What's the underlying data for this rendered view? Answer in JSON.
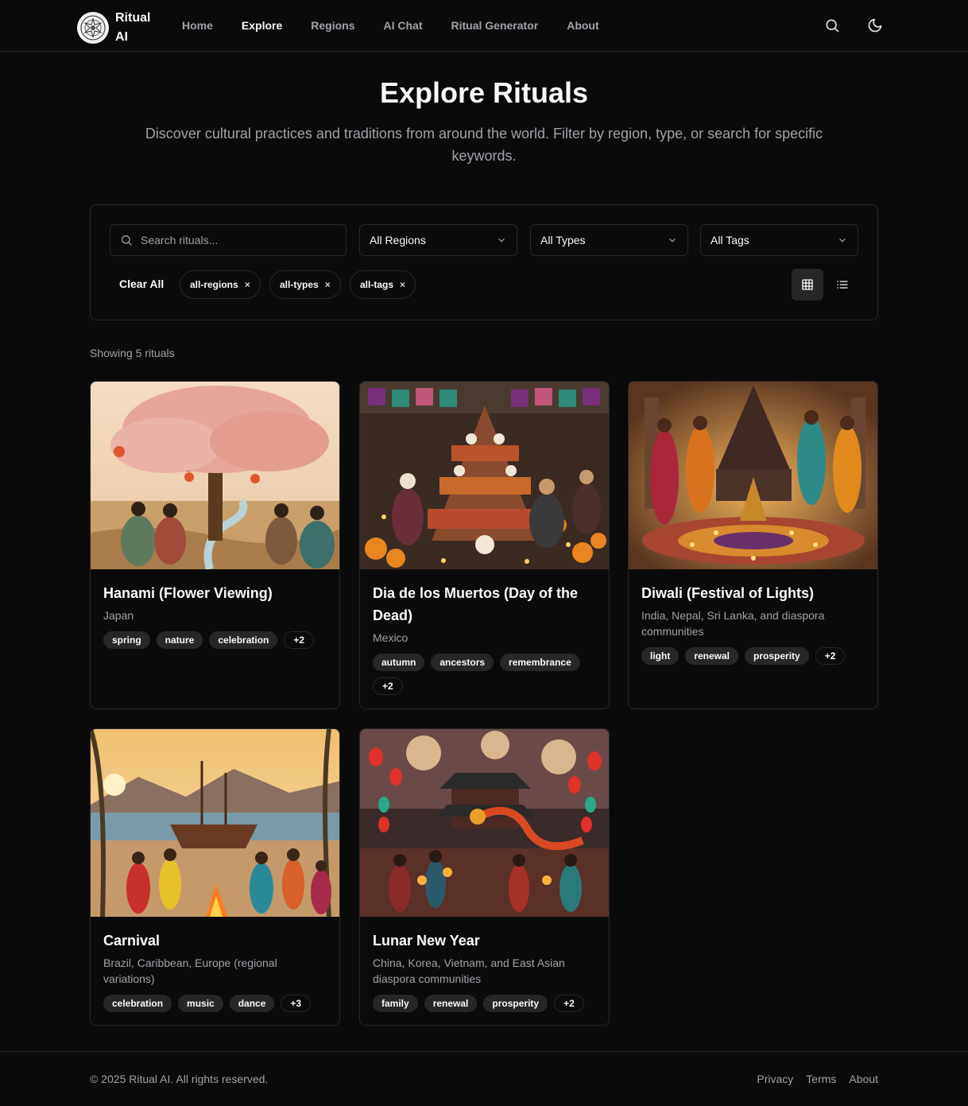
{
  "brand": {
    "name_line1": "Ritual",
    "name_line2": "AI"
  },
  "nav": {
    "items": [
      {
        "label": "Home",
        "active": false
      },
      {
        "label": "Explore",
        "active": true
      },
      {
        "label": "Regions",
        "active": false
      },
      {
        "label": "AI Chat",
        "active": false
      },
      {
        "label": "Ritual Generator",
        "active": false
      },
      {
        "label": "About",
        "active": false
      }
    ]
  },
  "header": {
    "search_icon": "search-icon",
    "theme_icon": "moon-icon"
  },
  "hero": {
    "title": "Explore Rituals",
    "subtitle": "Discover cultural practices and traditions from around the world. Filter by region, type, or search for specific keywords."
  },
  "filters": {
    "search_placeholder": "Search rituals...",
    "region_select": "All Regions",
    "type_select": "All Types",
    "tag_select": "All Tags",
    "clear_all": "Clear All",
    "chips": [
      "all-regions",
      "all-types",
      "all-tags"
    ],
    "chip_remove": "×"
  },
  "results": {
    "count_text": "Showing 5 rituals"
  },
  "cards": [
    {
      "title": "Hanami (Flower Viewing)",
      "region": "Japan",
      "tags": [
        "spring",
        "nature",
        "celebration"
      ],
      "more": "+2"
    },
    {
      "title": "Dia de los Muertos (Day of the Dead)",
      "region": "Mexico",
      "tags": [
        "autumn",
        "ancestors",
        "remembrance"
      ],
      "more": "+2"
    },
    {
      "title": "Diwali (Festival of Lights)",
      "region": "India, Nepal, Sri Lanka, and diaspora communities",
      "tags": [
        "light",
        "renewal",
        "prosperity"
      ],
      "more": "+2"
    },
    {
      "title": "Carnival",
      "region": "Brazil, Caribbean, Europe (regional variations)",
      "tags": [
        "celebration",
        "music",
        "dance"
      ],
      "more": "+3"
    },
    {
      "title": "Lunar New Year",
      "region": "China, Korea, Vietnam, and East Asian diaspora communities",
      "tags": [
        "family",
        "renewal",
        "prosperity"
      ],
      "more": "+2"
    }
  ],
  "footer": {
    "copyright": "© 2025 Ritual AI. All rights reserved.",
    "links": [
      "Privacy",
      "Terms",
      "About"
    ]
  },
  "colors": {
    "background": "#0a0a0a",
    "border": "#27272a",
    "muted_text": "#a1a1aa",
    "tag_bg": "#27272a"
  }
}
